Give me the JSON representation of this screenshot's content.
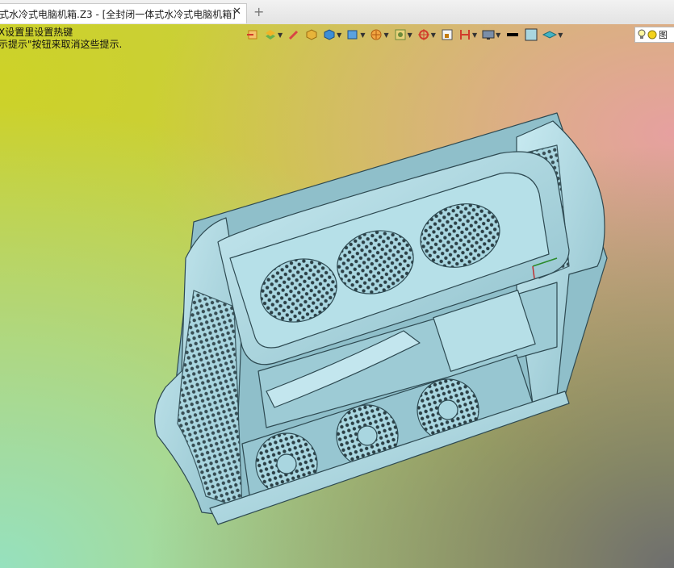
{
  "tabs": {
    "active_title": "式水冷式电脑机箱.Z3 - [全封闭一体式水冷式电脑机箱]",
    "close_glyph": "✕",
    "new_tab_glyph": "+"
  },
  "hints": [
    "X设置里设置热键",
    "示提示\"按钮来取消这些提示."
  ],
  "toolbar": {
    "search_text": "图",
    "icons": [
      "exit-icon",
      "layers-icon",
      "pen-icon",
      "solid-box-icon",
      "cube-icon",
      "view-cube-icon",
      "render-sphere-icon",
      "material-icon",
      "crosshair-icon",
      "frame-icon",
      "dimension-icon",
      "monitor-icon",
      "line-style-icon",
      "color-swatch-icon",
      "plane-icon",
      "light-bulb-icon",
      "sun-icon"
    ]
  },
  "colors": {
    "model_fill": "#a9d6e0",
    "model_edge": "#2e4a52",
    "bg_top_left": "#cdd228",
    "bg_top_right": "#e6a0a0",
    "bg_bottom_left": "#96e1be",
    "bg_bottom_right": "#6e6e6e"
  }
}
